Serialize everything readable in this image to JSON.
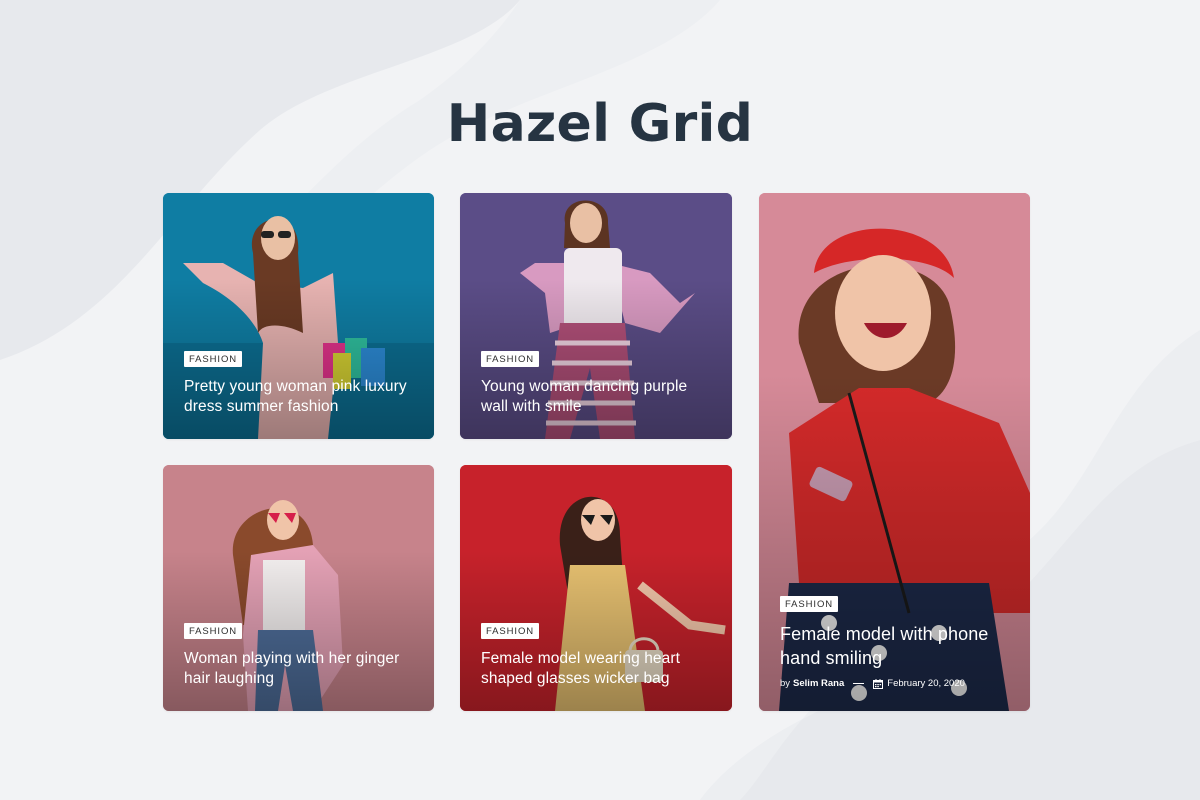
{
  "page": {
    "title": "Hazel Grid"
  },
  "cards": [
    {
      "category": "FASHION",
      "title": "Pretty young woman pink luxury dress summer fashion"
    },
    {
      "category": "FASHION",
      "title": "Young woman dancing purple wall with smile"
    },
    {
      "category": "FASHION",
      "title": "Woman playing with her ginger hair laughing"
    },
    {
      "category": "FASHION",
      "title": "Female model wearing heart shaped glasses wicker bag"
    },
    {
      "category": "FASHION",
      "title": "Female model with phone hand smiling",
      "meta": {
        "by": "by",
        "author": "Selim Rana",
        "date": "February 20, 2020"
      }
    }
  ],
  "colors": {
    "background": "#f2f3f5",
    "title": "#263442",
    "card1": "#0f7da3",
    "card2": "#5b4d87",
    "card3": "#c7838b",
    "card4": "#c7222b",
    "card5": "#d68a98"
  },
  "icons": [
    "calendar-icon"
  ]
}
